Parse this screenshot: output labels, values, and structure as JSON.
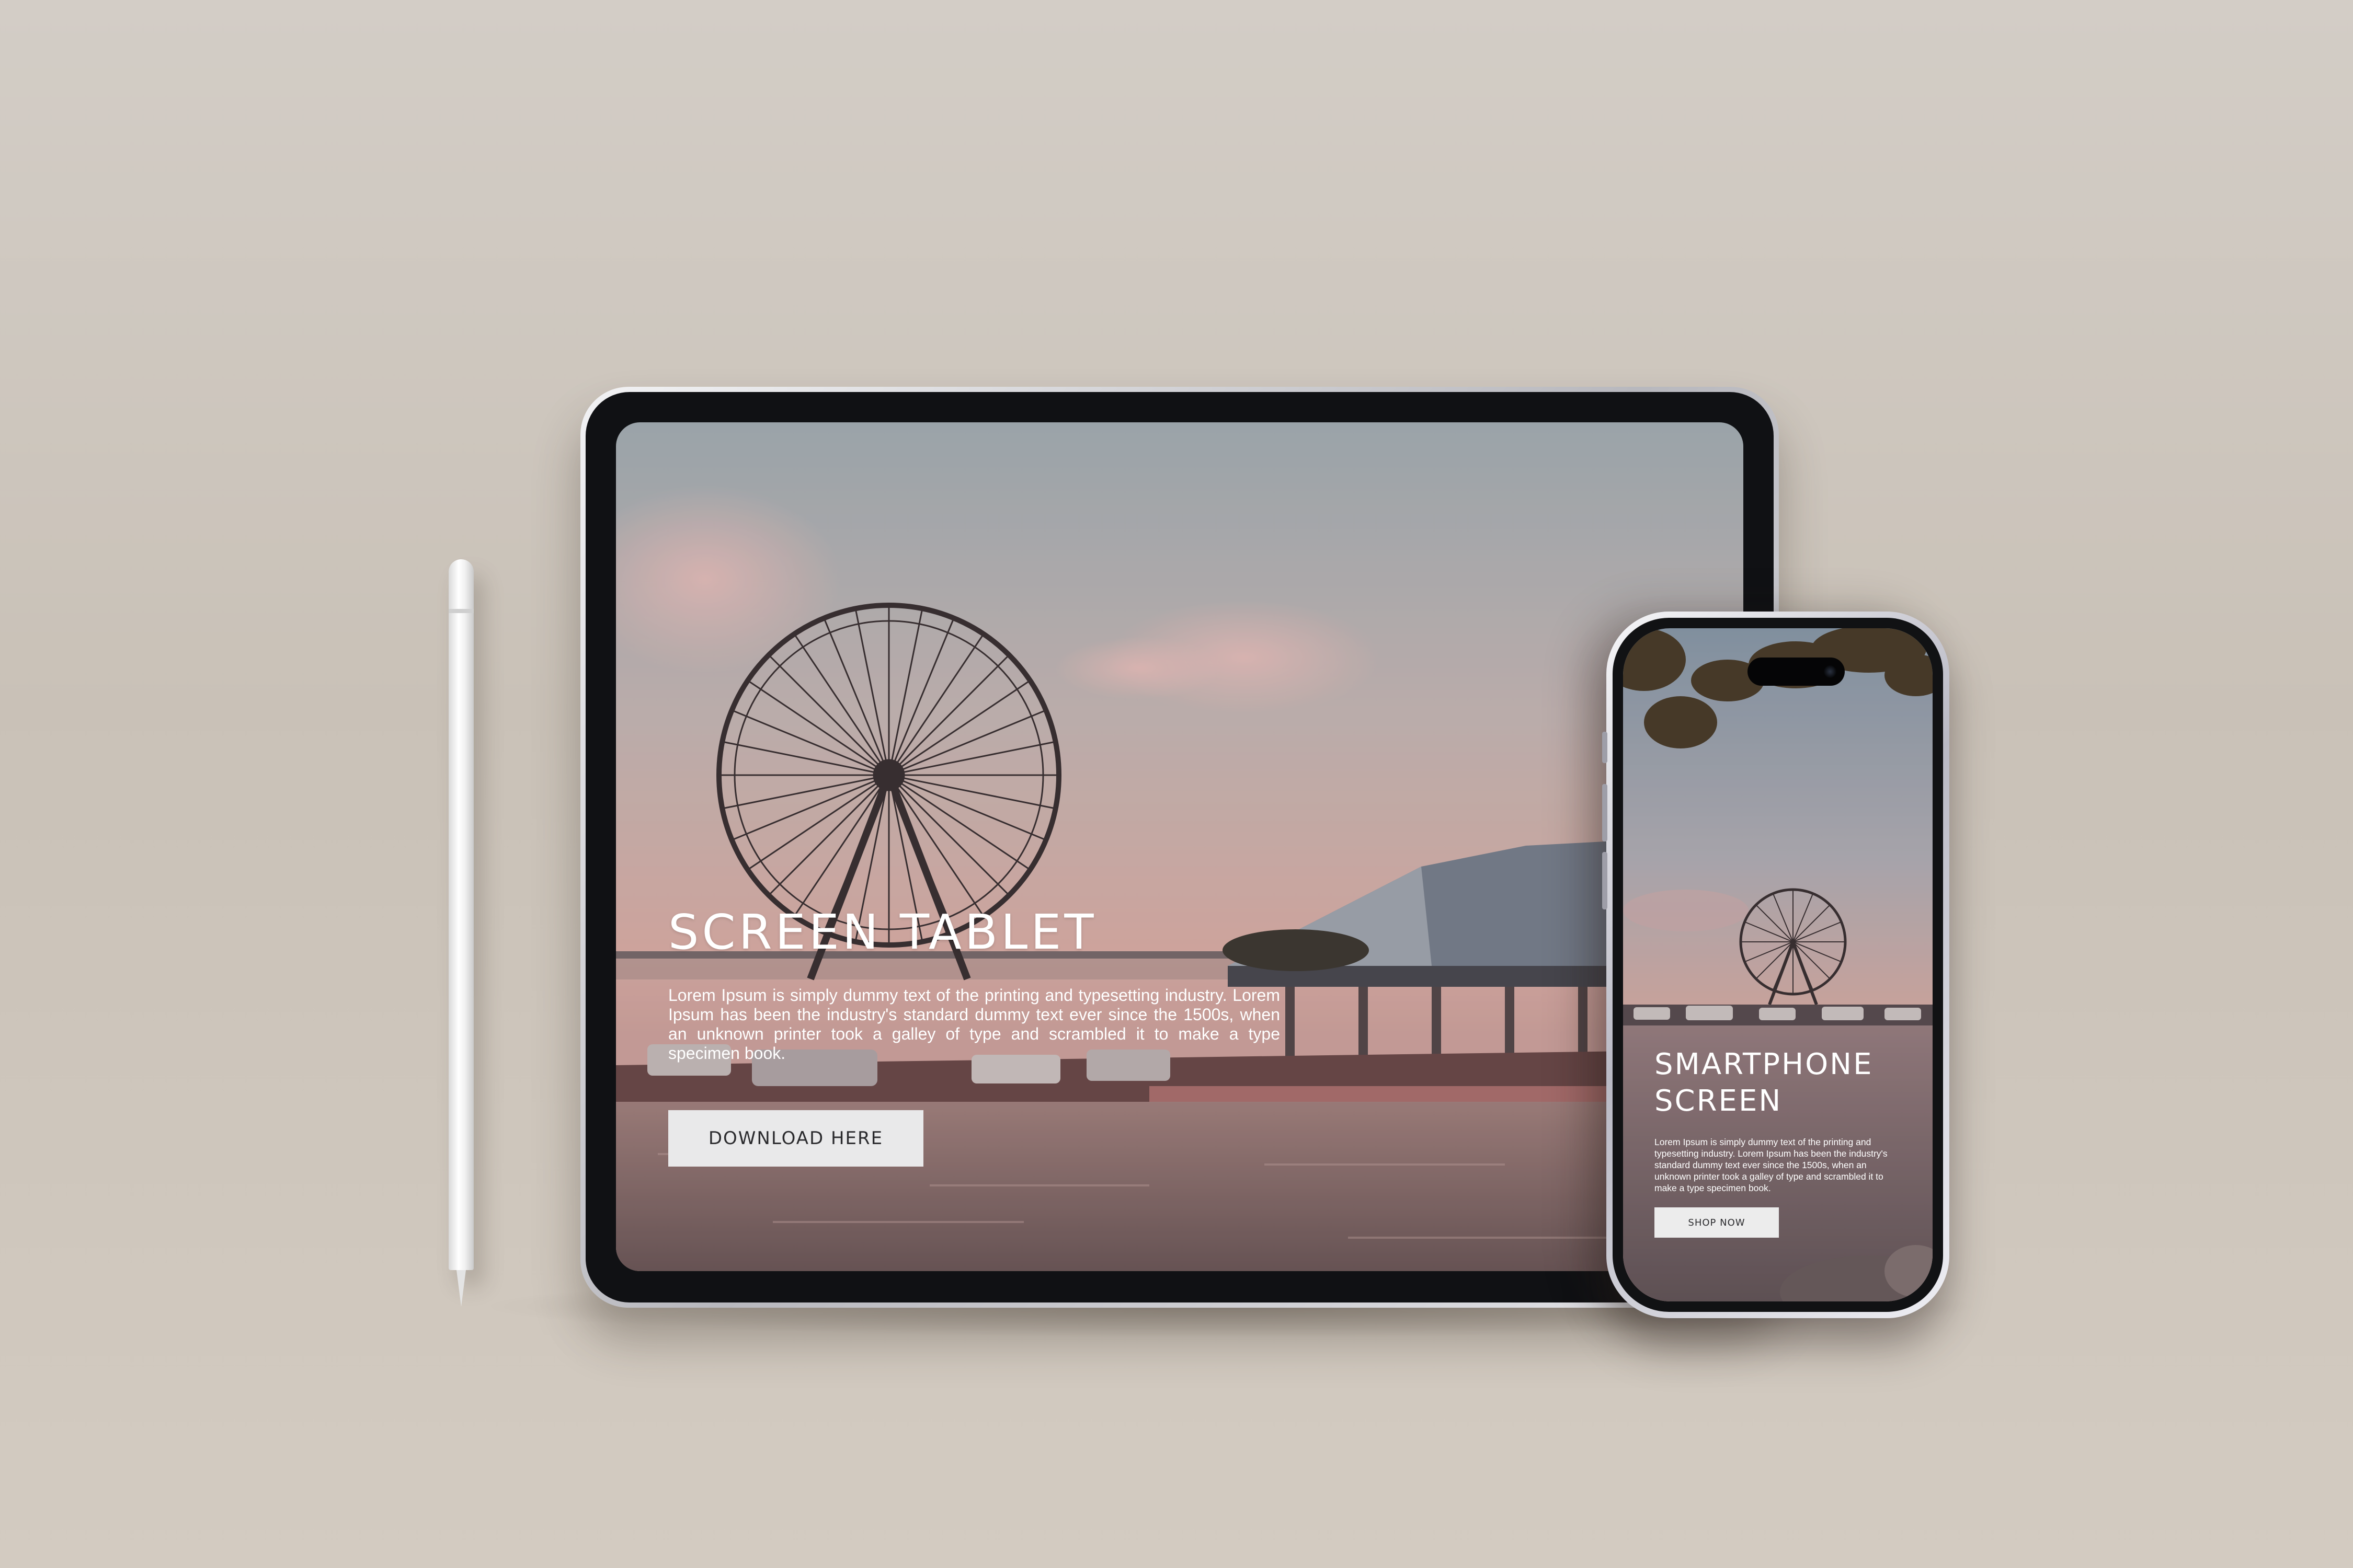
{
  "tablet": {
    "title": "SCREEN TABLET",
    "body": "Lorem Ipsum is simply dummy text of the printing and typesetting industry. Lorem Ipsum has been the industry's standard dummy text ever since the 1500s, when an unknown printer took a galley of type and scrambled it to make a type specimen book.",
    "button_label": "DOWNLOAD HERE"
  },
  "phone": {
    "title": "SMARTPHONE SCREEN",
    "body": "Lorem Ipsum is simply dummy text of the printing and typesetting industry. Lorem Ipsum has been the industry's standard dummy text ever since the 1500s, when an unknown printer took a galley of type and scrambled it to make a type specimen book.",
    "button_label": "SHOP NOW"
  },
  "colors": {
    "background": "#cdc6bd",
    "sky_top": "#9aa9b2",
    "sky_pink": "#e7b8b1",
    "water": "#8c7573",
    "button_bg": "#e9e9ea",
    "button_text": "#2b2b2e"
  },
  "icons": [
    "stylus",
    "dynamic-island-camera"
  ]
}
